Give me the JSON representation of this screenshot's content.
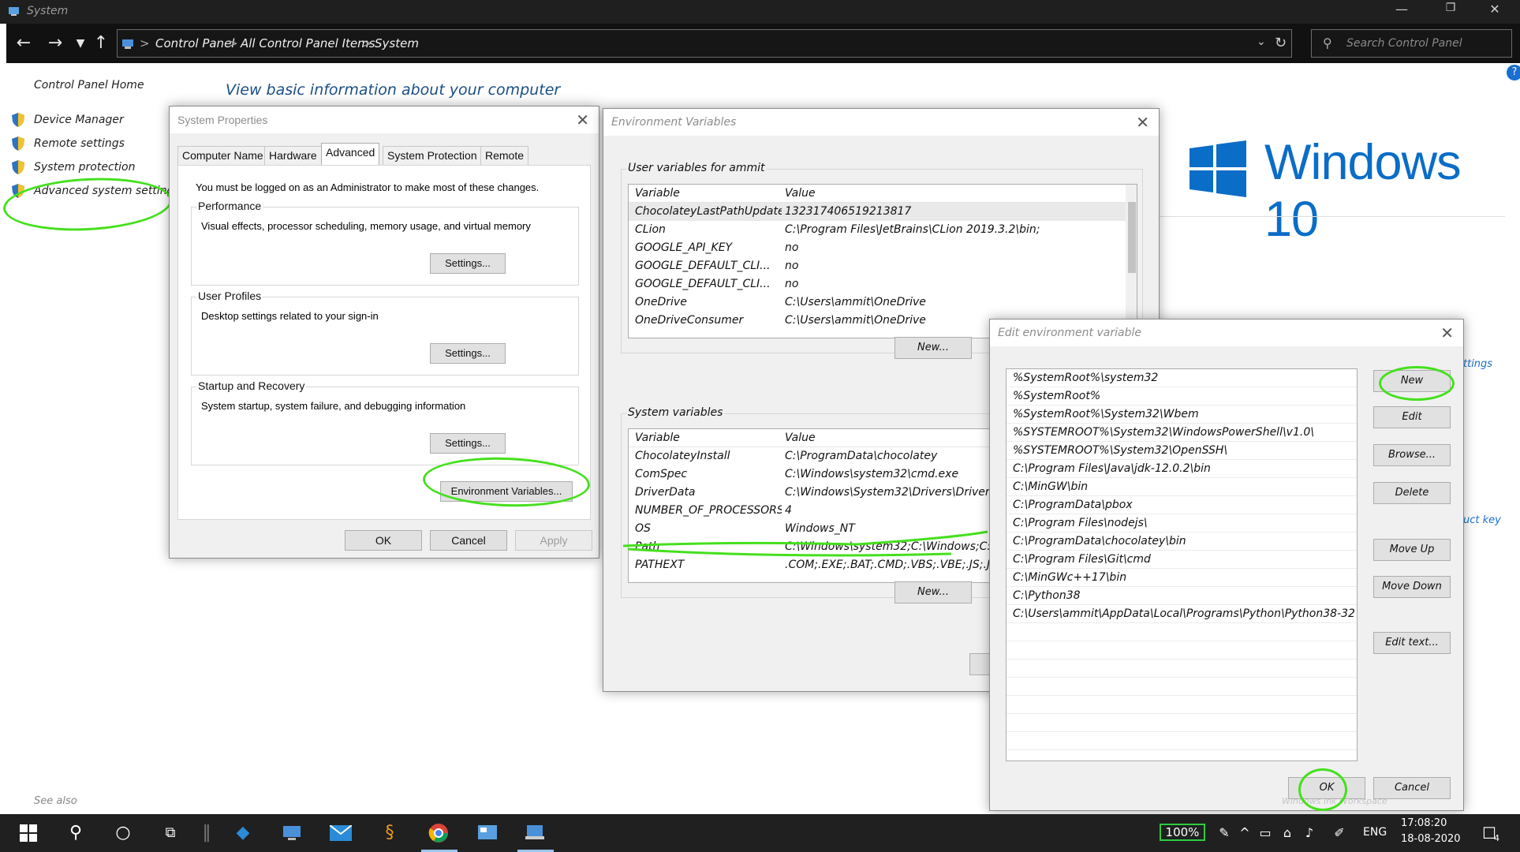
{
  "window": {
    "title": "System",
    "minimize": "—",
    "restore": "❐",
    "close": "✕"
  },
  "address": {
    "breadcrumbs": [
      "Control Panel",
      "All Control Panel Items",
      "System"
    ],
    "separator": ">",
    "search_placeholder": "Search Control Panel"
  },
  "left_pane": {
    "home": "Control Panel Home",
    "links": [
      "Device Manager",
      "Remote settings",
      "System protection",
      "Advanced system settings"
    ],
    "see_also": "See also"
  },
  "main": {
    "heading": "View basic information about your computer",
    "windows_brand": "Windows 10",
    "partial_text_1": "ttings",
    "partial_text_2": "uct key",
    "help": "?"
  },
  "system_properties": {
    "title": "System Properties",
    "tabs": [
      "Computer Name",
      "Hardware",
      "Advanced",
      "System Protection",
      "Remote"
    ],
    "active_tab": "Advanced",
    "admin_note": "You must be logged on as an Administrator to make most of these changes.",
    "groups": [
      {
        "label": "Performance",
        "text": "Visual effects, processor scheduling, memory usage, and virtual memory",
        "button": "Settings..."
      },
      {
        "label": "User Profiles",
        "text": "Desktop settings related to your sign-in",
        "button": "Settings..."
      },
      {
        "label": "Startup and Recovery",
        "text": "System startup, system failure, and debugging information",
        "button": "Settings..."
      }
    ],
    "env_button": "Environment Variables...",
    "ok": "OK",
    "cancel": "Cancel",
    "apply": "Apply"
  },
  "env_vars": {
    "title": "Environment Variables",
    "user_label": "User variables for ammit",
    "col_variable": "Variable",
    "col_value": "Value",
    "user_vars": [
      {
        "name": "ChocolateyLastPathUpdate",
        "value": "132317406519213817"
      },
      {
        "name": "CLion",
        "value": "C:\\Program Files\\JetBrains\\CLion 2019.3.2\\bin;"
      },
      {
        "name": "GOOGLE_API_KEY",
        "value": "no"
      },
      {
        "name": "GOOGLE_DEFAULT_CLI...",
        "value": "no"
      },
      {
        "name": "GOOGLE_DEFAULT_CLI...",
        "value": "no"
      },
      {
        "name": "OneDrive",
        "value": "C:\\Users\\ammit\\OneDrive"
      },
      {
        "name": "OneDriveConsumer",
        "value": "C:\\Users\\ammit\\OneDrive"
      }
    ],
    "user_new": "New...",
    "system_label": "System variables",
    "system_vars": [
      {
        "name": "ChocolateyInstall",
        "value": "C:\\ProgramData\\chocolatey"
      },
      {
        "name": "ComSpec",
        "value": "C:\\Windows\\system32\\cmd.exe"
      },
      {
        "name": "DriverData",
        "value": "C:\\Windows\\System32\\Drivers\\DriverData"
      },
      {
        "name": "NUMBER_OF_PROCESSORS",
        "value": "4"
      },
      {
        "name": "OS",
        "value": "Windows_NT"
      },
      {
        "name": "Path",
        "value": "C:\\Windows\\system32;C:\\Windows;C:\\Windo..."
      },
      {
        "name": "PATHEXT",
        "value": ".COM;.EXE;.BAT;.CMD;.VBS;.VBE;.JS;.JSE;..."
      }
    ],
    "system_new": "New..."
  },
  "edit_env": {
    "title": "Edit environment variable",
    "entries": [
      "%SystemRoot%\\system32",
      "%SystemRoot%",
      "%SystemRoot%\\System32\\Wbem",
      "%SYSTEMROOT%\\System32\\WindowsPowerShell\\v1.0\\",
      "%SYSTEMROOT%\\System32\\OpenSSH\\",
      "C:\\Program Files\\Java\\jdk-12.0.2\\bin",
      "C:\\MinGW\\bin",
      "C:\\ProgramData\\pbox",
      "C:\\Program Files\\nodejs\\",
      "C:\\ProgramData\\chocolatey\\bin",
      "C:\\Program Files\\Git\\cmd",
      "C:\\MinGWc++17\\bin",
      "C:\\Python38",
      "C:\\Users\\ammit\\AppData\\Local\\Programs\\Python\\Python38-32"
    ],
    "buttons": [
      "New",
      "Edit",
      "Browse...",
      "Delete",
      "Move Up",
      "Move Down",
      "Edit text..."
    ],
    "ok": "OK",
    "cancel": "Cancel",
    "watermark": "Windows Ink Workspace"
  },
  "taskbar": {
    "battery": "100%",
    "lang": "ENG",
    "time": "17:08:20",
    "date": "18-08-2020",
    "notif_count": "4"
  },
  "colors": {
    "highlight": "#45e01d",
    "heading_blue": "#1a4e85",
    "win_blue": "#0a6dc7"
  }
}
